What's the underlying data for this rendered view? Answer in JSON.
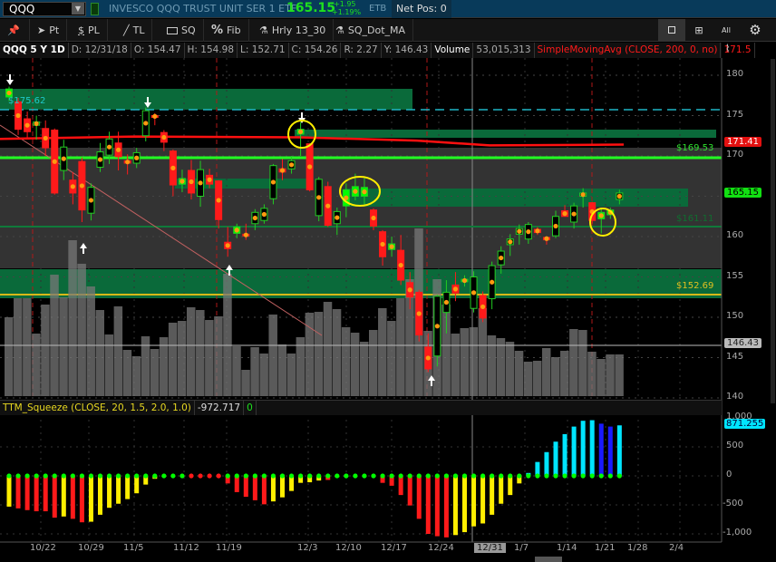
{
  "header": {
    "symbol": "QQQ",
    "description": "INVESCO QQQ TRUST UNIT SER 1 ETF",
    "last": "165.15",
    "change": "+1.95",
    "change_pct": "+1.19%",
    "etb": "ETB",
    "net_pos": "Net Pos: 0"
  },
  "toolbar": {
    "pt": "Pt",
    "pl": "PL",
    "tl": "TL",
    "sq": "SQ",
    "fib": "Fib",
    "study1": "Hrly 13_30",
    "study2": "SQ_Dot_MA",
    "all": "All"
  },
  "info": {
    "title": "QQQ 5 Y 1D",
    "date": "D: 12/31/18",
    "open": "O: 154.47",
    "high": "H: 154.98",
    "low": "L: 152.71",
    "close": "C: 154.26",
    "range": "R: 2.27",
    "y": "Y: 146.43",
    "volume_label": "Volume",
    "volume": "53,015,313",
    "sma": "SimpleMovingAvg (CLOSE, 200, 0, no)",
    "sma_value": "171.5"
  },
  "price_axis": [
    "180",
    "175",
    "170",
    "165",
    "160",
    "155",
    "150",
    "145",
    "140"
  ],
  "price_labels": {
    "sma": "171.41",
    "last": "165.15",
    "prev": "146.43",
    "level_175": "$175.62",
    "level_169": "$169.53",
    "level_161": "$161.11",
    "level_152": "$152.69"
  },
  "squeeze": {
    "title": "TTM_Squeeze (CLOSE, 20, 1.5, 2.0, 1.0)",
    "value": "-972.717",
    "flag": "0",
    "last_label": "871.255",
    "axis": [
      "1,000",
      "500",
      "0",
      "-500",
      "-1,000"
    ]
  },
  "dates": [
    "10/22",
    "10/29",
    "11/5",
    "11/12",
    "11/19",
    "12/3",
    "12/10",
    "12/17",
    "12/24",
    "12/31",
    "1/7",
    "1/14",
    "1/21",
    "1/28",
    "2/4"
  ],
  "colors": {
    "up": "#22cc22",
    "down": "#ff1a1a",
    "accent": "#00ff00",
    "sma": "#ff1010",
    "cyan": "#00e5ff",
    "blue": "#1a1aff",
    "yellow": "#ffee00"
  },
  "chart_data": {
    "type": "candlestick",
    "candles": [
      [
        177.3,
        178.6,
        176.8,
        178.3,
        1
      ],
      [
        176.7,
        177.2,
        172.6,
        173.3,
        0
      ],
      [
        174.6,
        175.5,
        172.3,
        173.0,
        0
      ],
      [
        173.8,
        175.0,
        172.0,
        174.2,
        0
      ],
      [
        173.4,
        174.4,
        170.0,
        171.0,
        0
      ],
      [
        173.2,
        173.4,
        165.2,
        165.4,
        0
      ],
      [
        168.2,
        172.0,
        167.0,
        171.1,
        0
      ],
      [
        167.0,
        168.0,
        164.0,
        165.4,
        0
      ],
      [
        169.3,
        169.8,
        161.8,
        163.3,
        0
      ],
      [
        162.9,
        166.6,
        162.0,
        166.1,
        0
      ],
      [
        168.6,
        171.6,
        168.0,
        170.5,
        0
      ],
      [
        170.1,
        173.0,
        169.0,
        172.1,
        0
      ],
      [
        171.6,
        173.0,
        168.2,
        169.9,
        0
      ],
      [
        169.4,
        170.2,
        167.7,
        169.1,
        0
      ],
      [
        169.1,
        171.0,
        168.5,
        170.4,
        0
      ],
      [
        172.5,
        176.0,
        171.8,
        175.6,
        0
      ],
      [
        175.0,
        175.3,
        173.8,
        174.8,
        0
      ],
      [
        172.9,
        173.2,
        170.6,
        171.7,
        0
      ],
      [
        170.6,
        170.8,
        165.0,
        166.4,
        0
      ],
      [
        166.5,
        168.3,
        165.5,
        167.2,
        1
      ],
      [
        168.2,
        169.5,
        164.6,
        165.4,
        0
      ],
      [
        165.0,
        169.4,
        163.7,
        168.3,
        0
      ],
      [
        167.6,
        168.4,
        166.0,
        166.5,
        0
      ],
      [
        166.9,
        167.0,
        161.0,
        162.1,
        0
      ],
      [
        159.3,
        161.2,
        157.5,
        158.5,
        0
      ],
      [
        160.4,
        161.6,
        159.8,
        161.2,
        1
      ],
      [
        160.3,
        161.6,
        159.6,
        160.1,
        0
      ],
      [
        161.6,
        163.4,
        160.8,
        163.0,
        0
      ],
      [
        162.0,
        164.0,
        161.6,
        163.5,
        0
      ],
      [
        164.7,
        169.0,
        164.0,
        168.8,
        0
      ],
      [
        168.4,
        169.6,
        167.0,
        168.0,
        0
      ],
      [
        168.4,
        170.0,
        167.8,
        169.4,
        0
      ],
      [
        172.7,
        174.2,
        170.0,
        173.3,
        1
      ],
      [
        171.5,
        171.6,
        165.6,
        165.8,
        0
      ],
      [
        162.6,
        167.4,
        161.9,
        167.1,
        0
      ],
      [
        166.2,
        166.8,
        161.2,
        161.4,
        0
      ],
      [
        161.6,
        163.6,
        160.2,
        163.1,
        0
      ],
      [
        163.8,
        166.6,
        162.4,
        165.8,
        1
      ],
      [
        165.0,
        167.8,
        164.5,
        166.2,
        1
      ],
      [
        165.0,
        167.4,
        164.0,
        166.1,
        1
      ],
      [
        163.3,
        163.5,
        160.8,
        161.3,
        0
      ],
      [
        160.6,
        160.8,
        156.4,
        157.5,
        0
      ],
      [
        158.4,
        160.0,
        157.5,
        159.1,
        1
      ],
      [
        158.3,
        160.2,
        154.0,
        154.6,
        0
      ],
      [
        154.3,
        155.6,
        151.0,
        152.5,
        0
      ],
      [
        153.1,
        153.4,
        147.0,
        147.8,
        0
      ],
      [
        146.3,
        148.0,
        143.2,
        143.6,
        0
      ],
      [
        145.2,
        152.8,
        143.9,
        152.6,
        0
      ],
      [
        150.6,
        154.6,
        148.0,
        153.1,
        0
      ],
      [
        154.0,
        155.6,
        152.0,
        153.0,
        0
      ],
      [
        154.4,
        155.2,
        153.8,
        154.7,
        1
      ],
      [
        151.1,
        155.7,
        150.6,
        155.0,
        0
      ],
      [
        152.7,
        153.2,
        149.4,
        149.9,
        0
      ],
      [
        152.3,
        156.9,
        151.0,
        156.4,
        0
      ],
      [
        156.5,
        158.8,
        155.4,
        158.2,
        0
      ],
      [
        159.0,
        160.3,
        157.6,
        159.7,
        0
      ],
      [
        160.3,
        161.5,
        159.0,
        161.0,
        0
      ],
      [
        159.7,
        161.8,
        159.1,
        161.5,
        0
      ],
      [
        160.9,
        161.2,
        160.2,
        160.5,
        0
      ],
      [
        159.9,
        160.0,
        159.0,
        159.6,
        0
      ],
      [
        160.1,
        163.2,
        159.8,
        162.5,
        0
      ],
      [
        163.2,
        163.9,
        162.5,
        162.5,
        0
      ],
      [
        161.8,
        164.2,
        161.0,
        163.8,
        0
      ],
      [
        165.0,
        166.0,
        163.6,
        165.4,
        0
      ],
      [
        164.2,
        164.3,
        161.6,
        162.0,
        0
      ],
      [
        162.2,
        163.6,
        160.4,
        163.0,
        1
      ],
      [
        162.7,
        163.6,
        162.2,
        163.3,
        1
      ],
      [
        164.6,
        165.8,
        164.0,
        165.4,
        0
      ]
    ],
    "volume_rel": [
      87,
      108,
      108,
      69,
      101,
      134,
      109,
      172,
      146,
      121,
      95,
      68,
      99,
      51,
      44,
      66,
      52,
      65,
      81,
      83,
      98,
      95,
      84,
      88,
      135,
      55,
      29,
      54,
      47,
      90,
      57,
      47,
      65,
      92,
      93,
      104,
      96,
      76,
      70,
      60,
      73,
      97,
      83,
      108,
      129,
      185,
      72,
      129,
      101,
      69,
      75,
      76,
      97,
      67,
      64,
      60,
      50,
      38,
      39,
      53,
      43,
      50,
      74,
      73,
      49,
      41,
      46,
      46
    ],
    "sma200": [
      [
        0,
        172.1
      ],
      [
        150,
        172.4
      ],
      [
        330,
        172.3
      ],
      [
        460,
        171.9
      ],
      [
        540,
        171.3
      ],
      [
        688,
        171.4
      ]
    ],
    "squeeze_hist": [
      -530,
      -560,
      -590,
      -610,
      -610,
      -720,
      -700,
      -740,
      -800,
      -790,
      -670,
      -550,
      -480,
      -400,
      -300,
      -150,
      -50,
      -10,
      -10,
      -10,
      -10,
      -10,
      -10,
      -20,
      -130,
      -280,
      -360,
      -420,
      -490,
      -440,
      -370,
      -260,
      -120,
      -110,
      -80,
      -70,
      -20,
      -5,
      -5,
      -5,
      -5,
      -120,
      -170,
      -330,
      -510,
      -740,
      -1000,
      -1040,
      -1060,
      -1020,
      -970,
      -870,
      -820,
      -670,
      -480,
      -330,
      -130,
      50,
      240,
      410,
      590,
      720,
      850,
      950,
      960,
      900,
      850,
      871
    ],
    "squeeze_hist_colors": [
      "y",
      "r",
      "r",
      "r",
      "r",
      "r",
      "y",
      "r",
      "r",
      "y",
      "y",
      "y",
      "y",
      "y",
      "y",
      "y",
      "y",
      "y",
      "y",
      "y",
      "r",
      "r",
      "r",
      "r",
      "r",
      "r",
      "r",
      "r",
      "r",
      "y",
      "y",
      "y",
      "y",
      "y",
      "y",
      "r",
      "y",
      "y",
      "y",
      "y",
      "y",
      "r",
      "r",
      "r",
      "r",
      "r",
      "r",
      "r",
      "r",
      "y",
      "y",
      "y",
      "y",
      "y",
      "y",
      "y",
      "y",
      "c",
      "c",
      "c",
      "c",
      "c",
      "c",
      "c",
      "c",
      "b",
      "b",
      "c"
    ],
    "squeeze_dots_red": [
      20,
      21,
      22,
      23
    ],
    "ylim_price": [
      140,
      182
    ],
    "ylim_squeeze": [
      -1100,
      1100
    ]
  }
}
